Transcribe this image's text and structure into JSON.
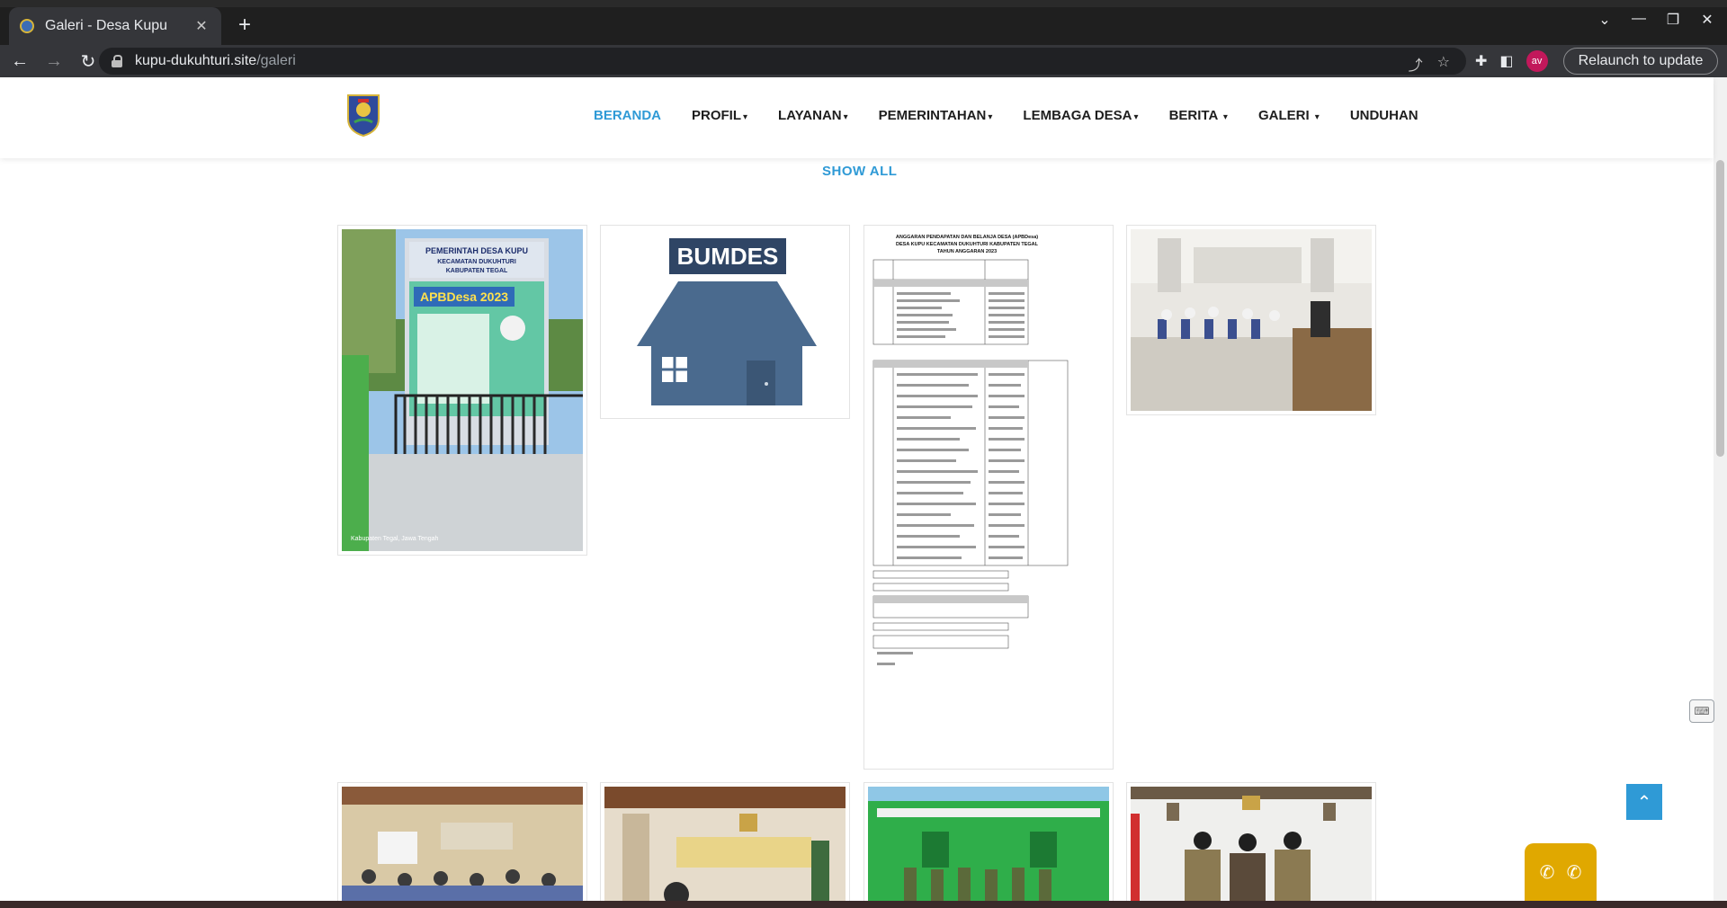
{
  "browser": {
    "tab_title": "Galeri - Desa Kupu",
    "tab_close": "✕",
    "new_tab": "+",
    "url_host": "kupu-dukuhturi.site",
    "url_path": "/galeri",
    "relaunch_label": "Relaunch to update",
    "avatar_initials": "av",
    "window_controls": [
      "⌄",
      "—",
      "❐",
      "✕"
    ]
  },
  "site": {
    "menu": [
      {
        "label": "BERANDA",
        "active": true,
        "caret": false
      },
      {
        "label": "PROFIL",
        "active": false,
        "caret": true
      },
      {
        "label": "LAYANAN",
        "active": false,
        "caret": true
      },
      {
        "label": "PEMERINTAHAN",
        "active": false,
        "caret": true
      },
      {
        "label": "LEMBAGA DESA",
        "active": false,
        "caret": true
      },
      {
        "label": "BERITA",
        "active": false,
        "caret": true
      },
      {
        "label": "GALERI",
        "active": false,
        "caret": true
      },
      {
        "label": "UNDUHAN",
        "active": false,
        "caret": false
      }
    ],
    "accent_color": "#2f9ad6"
  },
  "gallery": {
    "show_all_label": "SHOW ALL",
    "items": [
      {
        "alt": "Papan informasi APBDesa 2023",
        "sign_title": "PEMERINTAH DESA KUPU",
        "sign_sub1": "KECAMATAN DUKUHTURI",
        "sign_sub2": "KABUPATEN TEGAL",
        "sign_banner": "APBDesa 2023",
        "caption": "Kabupaten Tegal, Jawa Tengah"
      },
      {
        "alt": "BUMDES",
        "label": "BUMDES"
      },
      {
        "alt": "Tabel Anggaran APBDesa",
        "doc_title": "ANGGARAN PENDAPATAN DAN BELANJA DESA (APBDesa)",
        "doc_sub1": "DESA KUPU KECAMATAN DUKUHTURI KABUPATEN TEGAL",
        "doc_sub2": "TAHUN ANGGARAN 2023"
      },
      {
        "alt": "Rapat desa"
      },
      {
        "alt": "Sosialisasi di aula"
      },
      {
        "alt": "Penyuluhan"
      },
      {
        "alt": "Kegiatan di depan gedung hijau"
      },
      {
        "alt": "Penyerahan bantuan"
      }
    ]
  },
  "widgets": {
    "to_top": "⌃",
    "phone": "✆",
    "whatsapp": "✆"
  }
}
